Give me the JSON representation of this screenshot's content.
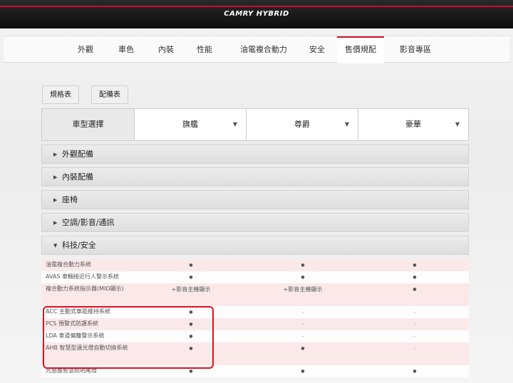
{
  "header": {
    "title": "CAMRY HYBRID"
  },
  "nav": {
    "items": [
      {
        "label": "外觀"
      },
      {
        "label": "車色"
      },
      {
        "label": "內裝"
      },
      {
        "label": "性能"
      },
      {
        "label": "油電複合動力"
      },
      {
        "label": "安全"
      },
      {
        "label": "售價規配"
      },
      {
        "label": "影音專區"
      }
    ],
    "active_index": 6
  },
  "buttons": {
    "spec": "規格表",
    "config": "配備表"
  },
  "selector": {
    "label": "車型選擇",
    "models": [
      "旗艦",
      "尊爵",
      "豪華"
    ]
  },
  "sections": [
    {
      "label": "外觀配備",
      "expanded": false
    },
    {
      "label": "內裝配備",
      "expanded": false
    },
    {
      "label": "座椅",
      "expanded": false
    },
    {
      "label": "空調/影音/通訊",
      "expanded": false
    },
    {
      "label": "科技/安全",
      "expanded": true
    }
  ],
  "rows": [
    {
      "name": "油電複合動力系統",
      "values": [
        "●",
        "●",
        "●"
      ]
    },
    {
      "name": "AVAS 車輛接近行人警示系統",
      "values": [
        "●",
        "●",
        "●"
      ]
    },
    {
      "name": "複合動力系統指示器(MID顯示)",
      "values": [
        "+影音主機顯示",
        "+影音主機顯示",
        "●"
      ]
    },
    {
      "name": "ACC 主動式車距維持系統",
      "values": [
        "●",
        "-",
        "-"
      ]
    },
    {
      "name": "PCS 預警式防護系統",
      "values": [
        "●",
        "-",
        "-"
      ]
    },
    {
      "name": "LDA 車道偏離警示系統",
      "values": [
        "●",
        "-",
        "-"
      ]
    },
    {
      "name": "AHB 智慧型遠光燈自動切換系統",
      "values": [
        "●",
        "●",
        "-"
      ]
    },
    {
      "name": "光感應智慧照明尾燈",
      "values": [
        "●",
        "●",
        "●"
      ]
    }
  ],
  "colors": {
    "accent": "#c8102e",
    "highlight": "#e0101f",
    "row_pink": "#fbe9ea"
  },
  "icons": {
    "expand": "triangle-right-icon",
    "collapse": "triangle-down-icon",
    "dropdown": "chevron-down-icon"
  }
}
